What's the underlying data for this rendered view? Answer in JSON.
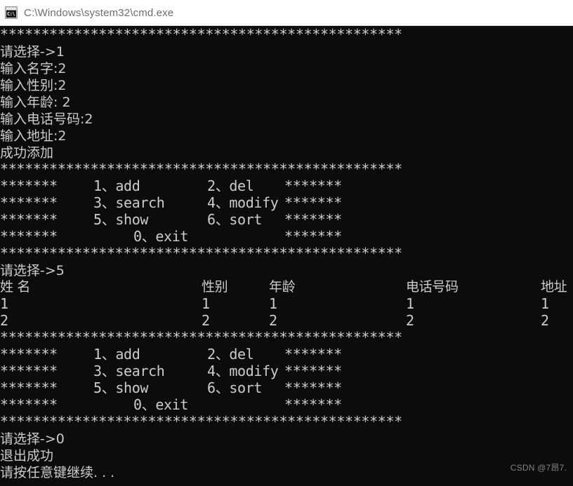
{
  "window": {
    "title": "C:\\Windows\\system32\\cmd.exe",
    "icon_name": "cmd-console-icon",
    "icon_glyph": "C:\\",
    "background_color": "#0c0c0c",
    "foreground_color": "#cccccc",
    "titlebar_color": "#ffffff",
    "titlebar_text_color": "#6e6e6e"
  },
  "console": {
    "separator_full": "*************************************************",
    "lines": [
      {
        "type": "separator"
      },
      {
        "type": "text",
        "text": "请选择->1"
      },
      {
        "type": "text",
        "text": "输入名字:2"
      },
      {
        "type": "text",
        "text": "输入性别:2"
      },
      {
        "type": "text",
        "text": "输入年龄: 2"
      },
      {
        "type": "text",
        "text": "输入电话号码:2"
      },
      {
        "type": "text",
        "text": "输入地址:2"
      },
      {
        "type": "text",
        "text": "成功添加"
      }
    ],
    "menu": {
      "stars_side": "*******",
      "rows": [
        {
          "left": "*******",
          "col1": "1、add",
          "col2": "2、del",
          "right": "*******"
        },
        {
          "left": "*******",
          "col1": "3、search",
          "col2": "4、modify",
          "right": "*******"
        },
        {
          "left": "*******",
          "col1": "5、show",
          "col2": "6、sort",
          "right": "*******"
        },
        {
          "left": "*******",
          "exit": "0、exit",
          "right": "*******"
        }
      ]
    },
    "prompt_show": "请选择->5",
    "prompt_exit": "请选择->0",
    "exit_message": "退出成功",
    "press_any_key": "请按任意键继续. . .",
    "table": {
      "headers": [
        "姓 名",
        "性别",
        "年龄",
        "电话号码",
        "地址"
      ],
      "rows": [
        [
          "1",
          "1",
          "1",
          "1",
          "1"
        ],
        [
          "2",
          "2",
          "2",
          "2",
          "2"
        ]
      ]
    }
  },
  "watermark": {
    "text": "CSDN @7昂7."
  }
}
